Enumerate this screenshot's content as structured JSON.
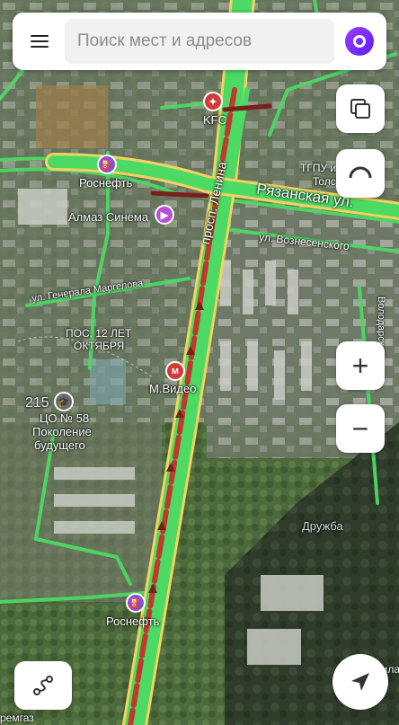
{
  "search": {
    "placeholder": "Поиск мест и адресов"
  },
  "streets": {
    "lenina": "просп. Ленина",
    "ryazanskaya": "Рязанская ул.",
    "voznesenskogo": "ул. Вознесенского",
    "margelova": "ул. Генерала Маргелова",
    "volodarskogo": "Володарского"
  },
  "places": {
    "kfc": "KFC",
    "rosneft_top": "Роснефть",
    "almaz": "Алмаз Синема",
    "pos_1": "ПОС. 12 ЛЕТ",
    "pos_2": "ОКТЯБРЯ",
    "mvideo": "М.Видео",
    "building_215": "215",
    "co58_1": "ЦО № 58",
    "co58_2": "Поколение",
    "co58_3": "будущего",
    "druzhba": "Дружба",
    "rosneft_bottom": "Роснефть",
    "tgpu_1": "ТГПУ и",
    "tgpu_2": "Толст",
    "sila": "Сила",
    "shemgaz": "ремгаз"
  },
  "controls": {
    "layers": "layers-icon",
    "zoom_in": "+",
    "zoom_out": "−",
    "route": "route-icon",
    "locate": "locate-icon"
  },
  "colors": {
    "traffic_green": "#4cd964",
    "traffic_red": "#c0392b",
    "traffic_darkred": "#7a1e1e",
    "road_yellow": "#f4d35e",
    "accent_purple": "#7b2cff"
  }
}
